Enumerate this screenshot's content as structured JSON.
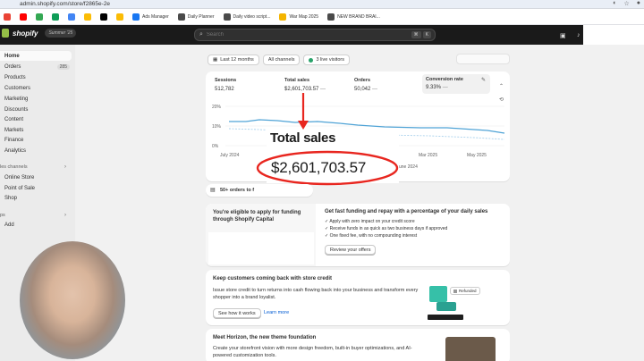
{
  "browser": {
    "url": "admin.shopify.com/store/f2865e-2e",
    "bookmarks": [
      {
        "label": "",
        "color": "#ea4335"
      },
      {
        "label": "",
        "color": "#ff0000"
      },
      {
        "label": "",
        "color": "#34a853"
      },
      {
        "label": "",
        "color": "#0f9d58"
      },
      {
        "label": "",
        "color": "#4285f4"
      },
      {
        "label": "",
        "color": "#fbbc05"
      },
      {
        "label": "",
        "color": "#000000"
      },
      {
        "label": "",
        "color": "#fbbc05"
      },
      {
        "label": "Ads Manager",
        "color": "#1877f2"
      },
      {
        "label": "Daily Planner",
        "color": "#4a4a4a"
      },
      {
        "label": "Daily video script...",
        "color": "#4a4a4a"
      },
      {
        "label": "War Map 2025",
        "color": "#f4b400"
      },
      {
        "label": "NEW BRAND BRAI...",
        "color": "#4a4a4a"
      }
    ]
  },
  "topbar": {
    "logo": "shopify",
    "edition": "Summer '25",
    "search_placeholder": "Search",
    "shortcut": [
      "⌘",
      "K"
    ]
  },
  "sidebar": {
    "items": [
      {
        "label": "Home",
        "active": true
      },
      {
        "label": "Orders",
        "badge": "285"
      },
      {
        "label": "Products"
      },
      {
        "label": "Customers"
      },
      {
        "label": "Marketing"
      },
      {
        "label": "Discounts"
      },
      {
        "label": "Content"
      },
      {
        "label": "Markets"
      },
      {
        "label": "Finance"
      },
      {
        "label": "Analytics"
      }
    ],
    "sales_channels_label": "les channels",
    "channels": [
      "Online Store",
      "Point of Sale",
      "Shop"
    ],
    "apps_label": "ps",
    "add_label": "Add"
  },
  "filters": {
    "range": "Last 12 months",
    "channels": "All channels",
    "live": "3 live visitors"
  },
  "metrics": [
    {
      "label": "Sessions",
      "value": "512,782"
    },
    {
      "label": "Total sales",
      "value": "$2,601,703.57"
    },
    {
      "label": "Orders",
      "value": "50,042"
    },
    {
      "label": "Conversion rate",
      "value": "9.33%"
    }
  ],
  "chart": {
    "y_ticks": [
      "20%",
      "10%",
      "0%"
    ],
    "x_ticks": [
      "July 2024",
      "Mar 2025",
      "May 2025"
    ],
    "x_tick_hidden": "une 2024"
  },
  "zoom": {
    "label": "Total sales",
    "value": "$2,601,703.57"
  },
  "orders_banner": "50+ orders to f",
  "funding": {
    "left_title": "You're eligible to apply for funding through Shopify Capital",
    "right_title": "Get fast funding and repay with a percentage of your daily sales",
    "bullets": [
      "Apply with zero impact on your credit score",
      "Receive funds in as quick as two business days if approved",
      "One fixed fee, with no compounding interest"
    ],
    "button": "Review your offers"
  },
  "credit": {
    "title": "Keep customers coming back with store credit",
    "body": "Issue store credit to turn returns into cash flowing back into your business and transform every shopper into a brand loyalist.",
    "primary": "See how it works",
    "link": "Learn more",
    "badge": "Refunded"
  },
  "horizon": {
    "title": "Meet Horizon, the new theme foundation",
    "body": "Create your storefront vision with more design freedom, built-in buyer optimizations, and AI-powered customization tools."
  },
  "colors": {
    "brand": "#95bf47",
    "annotation": "#e8261f",
    "link": "#005bd3",
    "live": "#29a36a",
    "line": "#4fa3d6"
  }
}
